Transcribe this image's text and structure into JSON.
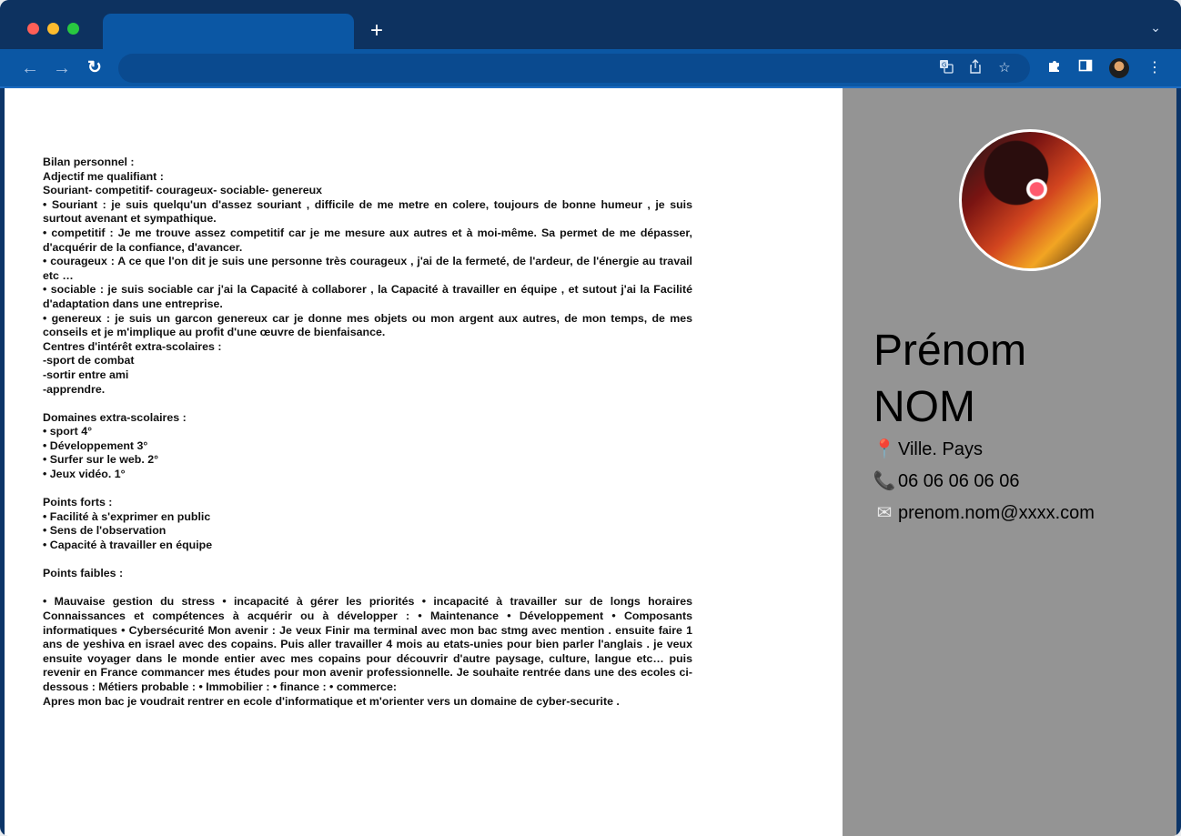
{
  "browser": {
    "tab_title": "",
    "new_tab_label": "+",
    "url": "",
    "icons": {
      "back": "arrow-left-icon",
      "forward": "arrow-right-icon",
      "reload": "reload-icon",
      "translate": "translate-icon",
      "share": "share-icon",
      "bookmark": "star-icon",
      "extensions": "puzzle-icon",
      "side_panel": "side-panel-icon",
      "menu": "kebab-menu-icon"
    }
  },
  "main": {
    "text": "Bilan personnel :\nAdjectif me qualifiant :\nSouriant- competitif- courageux- sociable- genereux\n• Souriant : je suis quelqu'un d'assez souriant , difficile de me metre en colere, toujours de bonne humeur , je suis surtout avenant et sympathique.\n• competitif : Je me trouve assez competitif car je me mesure aux autres et à moi-même. Sa permet de me dépasser, d'acquérir de la confiance, d'avancer.\n• courageux : A ce que l'on dit je suis une personne très courageux , j'ai de la fermeté, de l'ardeur, de l'énergie au travail etc …\n• sociable : je suis sociable car j'ai la Capacité à collaborer , la Capacité à travailler en équipe , et sutout j'ai la Facilité d'adaptation dans une entreprise.\n• genereux : je suis un garcon genereux car je donne mes objets ou mon argent aux autres, de mon temps, de mes conseils et je m'implique au profit d'une œuvre de bienfaisance.\nCentres d'intérêt extra-scolaires :\n-sport de combat\n-sortir entre ami\n-apprendre.\n\nDomaines extra-scolaires :\n• sport 4°\n• Développement 3°\n• Surfer sur le web. 2°\n• Jeux vidéo. 1°\n\nPoints forts :\n• Facilité à s'exprimer en public\n• Sens de l'observation\n• Capacité à travailler en équipe\n\nPoints faibles :\n\n• Mauvaise gestion du stress • incapacité à gérer les priorités • incapacité à travailler sur de longs horaires Connaissances et compétences à acquérir ou à développer : • Maintenance • Développement • Composants informatiques • Cybersécurité Mon avenir : Je veux Finir ma terminal avec mon bac stmg avec mention . ensuite faire 1 ans de yeshiva en israel avec des copains. Puis aller travailler 4 mois au etats-unies pour bien parler l'anglais . je veux ensuite voyager dans le monde entier avec mes copains pour découvrir d'autre paysage, culture, langue etc… puis revenir en France commancer mes études pour mon avenir professionnelle. Je souhaite rentrée dans une des ecoles ci-dessous : Métiers probable : • Immobilier : • finance : • commerce:\nApres mon bac je voudrait rentrer en ecole d'informatique et m'orienter vers un domaine de cyber-securite ."
  },
  "sidebar": {
    "name": "Prénom\nNOM",
    "location": "Ville. Pays",
    "phone": "06 06 06 06 06",
    "email": "prenom.nom@xxxx.com",
    "location_icon": "pin-icon",
    "phone_icon": "phone-icon",
    "email_icon": "envelope-icon",
    "colors": {
      "background": "#949494"
    }
  }
}
